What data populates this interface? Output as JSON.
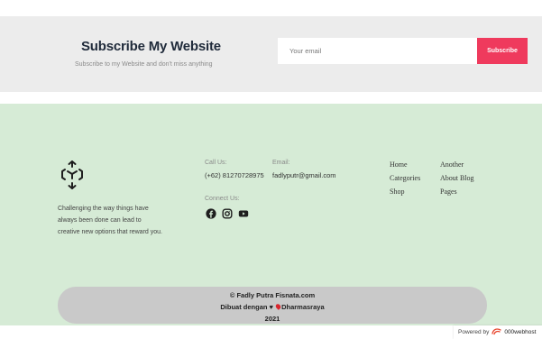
{
  "subscribe": {
    "title": "Subscribe My Website",
    "description": "Subscribe to my Website and don't miss anything",
    "email_placeholder": "Your email",
    "button_label": "Subscribe",
    "button_color": "#ef3a5d",
    "background": "#ececec"
  },
  "footer": {
    "background": "#d6ebd6",
    "logo_icon": "box-arrows-icon",
    "tagline": "Challenging the way things have always been done can lead to creative new options that reward you.",
    "call_label": "Call Us:",
    "call_value": "(+62) 81270728975",
    "email_label": "Email:",
    "email_value": "fadlyputr@gmail.com",
    "connect_label": "Connect Us:",
    "socials": [
      "facebook-icon",
      "instagram-icon",
      "youtube-icon"
    ],
    "links_col1": [
      "Home",
      "Categories",
      "Shop"
    ],
    "links_col2": [
      "Another",
      "About Blog",
      "Pages"
    ]
  },
  "copyright": {
    "line1": "© Fadly Putra Fisnata.com",
    "line2_prefix": "Dibuat dengan ♥ ",
    "line2_suffix": "Dharmasraya",
    "line3": "2021"
  },
  "powered": {
    "text": "Powered by",
    "brand": "000webhost"
  }
}
